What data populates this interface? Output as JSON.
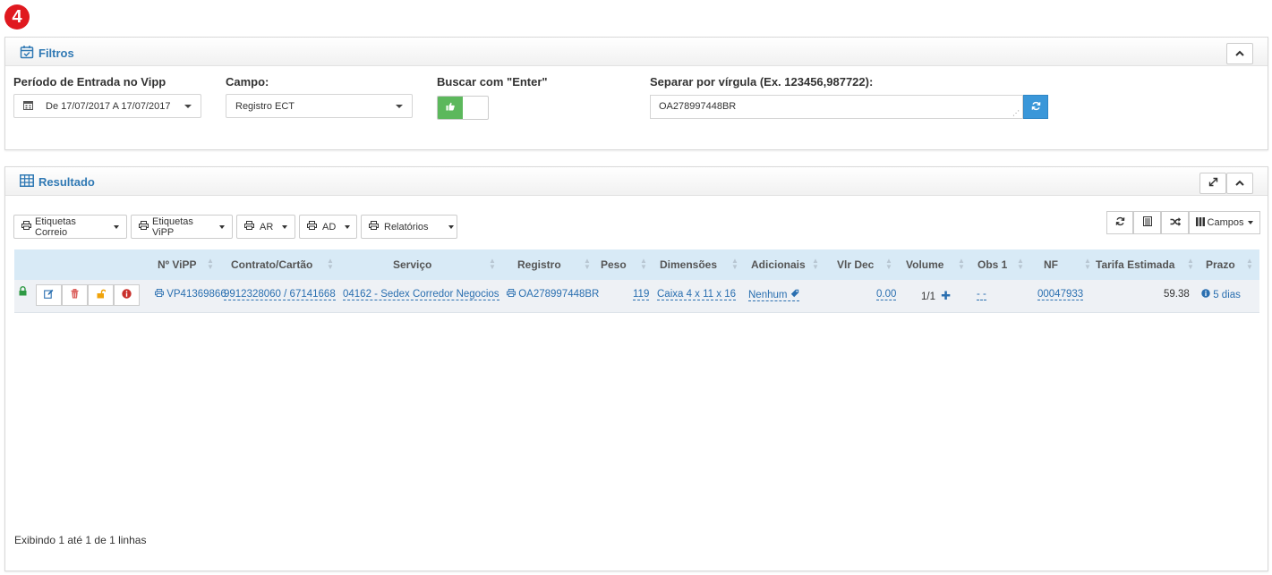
{
  "step_badge": "4",
  "filters": {
    "title": "Filtros",
    "periodo_label": "Período de Entrada no Vipp",
    "periodo_value": "De 17/07/2017 A 17/07/2017",
    "campo_label": "Campo:",
    "campo_value": "Registro ECT",
    "buscar_label": "Buscar com \"Enter\"",
    "separar_label": "Separar por vírgula (Ex. 123456,987722):",
    "separar_value": "OA278997448BR"
  },
  "result": {
    "title": "Resultado",
    "toolbar": {
      "etiquetas_correio": "Etiquetas Correio",
      "etiquetas_vipp": "Etiquetas ViPP",
      "ar": "AR",
      "ad": "AD",
      "relatorios": "Relatórios",
      "campos": "Campos"
    },
    "columns": {
      "vipp": "Nº ViPP",
      "contrato": "Contrato/Cartão",
      "servico": "Serviço",
      "registro": "Registro",
      "peso": "Peso",
      "dimensoes": "Dimensões",
      "adicionais": "Adicionais",
      "vlr_dec": "Vlr Dec",
      "volume": "Volume",
      "obs1": "Obs 1",
      "nf": "NF",
      "tarifa": "Tarifa Estimada",
      "prazo": "Prazo"
    },
    "row": {
      "vipp": "VP41369866",
      "contrato": "9912328060 / 67141668",
      "servico": "04162 - Sedex Corredor Negocios",
      "registro": "OA278997448BR",
      "peso": "119",
      "dimensoes": "Caixa 4 x 11 x 16",
      "adicionais": "Nenhum",
      "vlr_dec": "0.00",
      "volume": "1/1",
      "obs1": "- -",
      "nf": "00047933",
      "tarifa": "59.38",
      "prazo": "5 dias"
    },
    "footer": "Exibindo 1 até 1 de 1 linhas"
  },
  "colors": {
    "accent": "#3079b4",
    "link": "#2a6fb0",
    "toggle_on": "#5cb85c",
    "badge": "#e0191f"
  }
}
